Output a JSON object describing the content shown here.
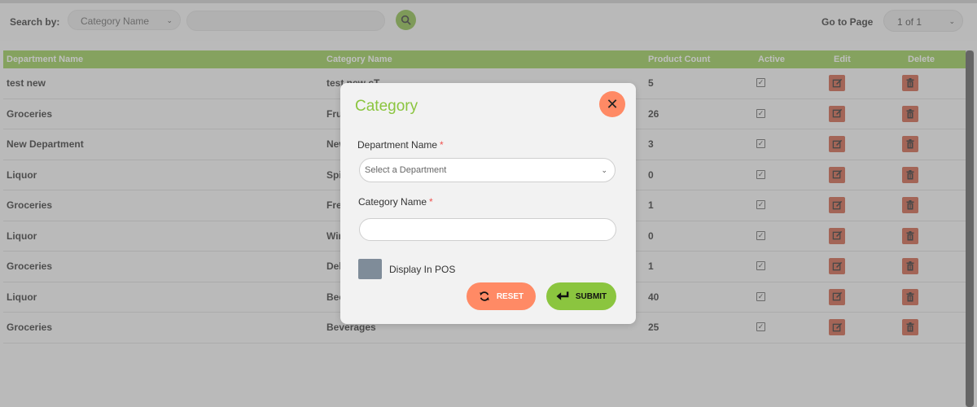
{
  "search": {
    "label": "Search by:",
    "filter_selected": "Category Name",
    "query_value": "",
    "goto_label": "Go to Page",
    "page_selected": "1 of 1"
  },
  "table": {
    "headers": [
      "Department Name",
      "Category Name",
      "Product Count",
      "Active",
      "Edit",
      "Delete"
    ],
    "rows": [
      {
        "department": "test new",
        "category": "test new cT",
        "count": "5"
      },
      {
        "department": "Groceries",
        "category": "Fruits",
        "count": "26"
      },
      {
        "department": "New Department",
        "category": "New",
        "count": "3"
      },
      {
        "department": "Liquor",
        "category": "Spirits",
        "count": "0"
      },
      {
        "department": "Groceries",
        "category": "Fresh",
        "count": "1"
      },
      {
        "department": "Liquor",
        "category": "Wine",
        "count": "0"
      },
      {
        "department": "Groceries",
        "category": "Deli",
        "count": "1"
      },
      {
        "department": "Liquor",
        "category": "Beer",
        "count": "40"
      },
      {
        "department": "Groceries",
        "category": "Beverages",
        "count": "25"
      }
    ]
  },
  "modal": {
    "title": "Category",
    "close_icon": "close-icon",
    "department_label": "Department Name",
    "required_mark": "*",
    "department_placeholder": "Select a Department",
    "category_label": "Category Name",
    "category_value": "",
    "display_pos_label": "Display In POS",
    "reset_label": "RESET",
    "submit_label": "SUBMIT"
  },
  "colors": {
    "accent_green": "#8bc53f",
    "danger": "#c64a2e",
    "reset_salmon": "#ff8a65"
  }
}
